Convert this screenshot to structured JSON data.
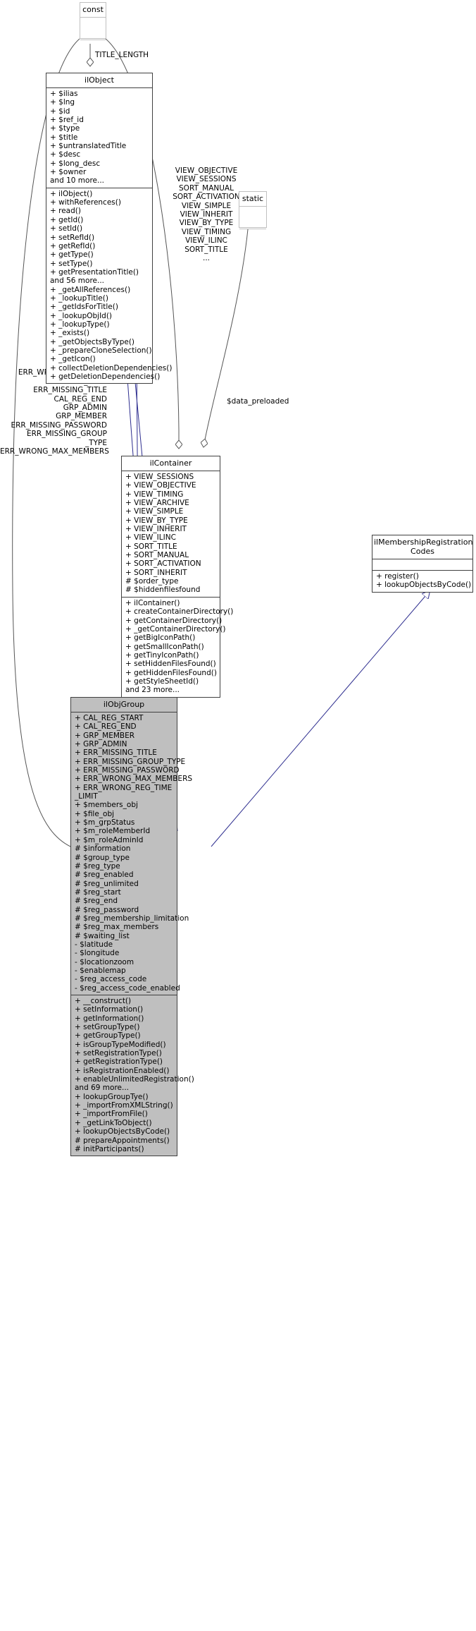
{
  "diagram": {
    "kind": "uml-class-diagram",
    "title": "ilObjGroup class inheritance / collaboration diagram",
    "colors": {
      "inherit_edge": "#2e2e8f",
      "assoc_edge": "#555555",
      "node_border": "#404040",
      "node_border_light": "#c0c0c0",
      "highlight_fill": "#bfbfbf",
      "background": "#ffffff"
    }
  },
  "nodes": {
    "const": {
      "name": "const",
      "attributes": [],
      "methods": []
    },
    "static": {
      "name": "static",
      "attributes": [],
      "methods": []
    },
    "ilObject": {
      "name": "ilObject",
      "attributes": [
        "+ $ilias",
        "+ $lng",
        "+ $id",
        "+ $ref_id",
        "+ $type",
        "+ $title",
        "+ $untranslatedTitle",
        "+ $desc",
        "+ $long_desc",
        "+ $owner",
        "and 10 more..."
      ],
      "methods": [
        "+ ilObject()",
        "+ withReferences()",
        "+ read()",
        "+ getId()",
        "+ setId()",
        "+ setRefId()",
        "+ getRefId()",
        "+ getType()",
        "+ setType()",
        "+ getPresentationTitle()",
        "and 56 more...",
        "+ _getAllReferences()",
        "+ _lookupTitle()",
        "+ _getIdsForTitle()",
        "+ _lookupObjId()",
        "+ _lookupType()",
        "+ _exists()",
        "+ _getObjectsByType()",
        "+ _prepareCloneSelection()",
        "+ _getIcon()",
        "+ collectDeletionDependencies()",
        "+ getDeletionDependencies()"
      ]
    },
    "ilContainer": {
      "name": "ilContainer",
      "attributes": [
        "+ VIEW_SESSIONS",
        "+ VIEW_OBJECTIVE",
        "+ VIEW_TIMING",
        "+ VIEW_ARCHIVE",
        "+ VIEW_SIMPLE",
        "+ VIEW_BY_TYPE",
        "+ VIEW_INHERIT",
        "+ VIEW_ILINC",
        "+ SORT_TITLE",
        "+ SORT_MANUAL",
        "+ SORT_ACTIVATION",
        "+ SORT_INHERIT",
        "# $order_type",
        "# $hiddenfilesfound"
      ],
      "methods": [
        "+ ilContainer()",
        "+ createContainerDirectory()",
        "+ getContainerDirectory()",
        "+ _getContainerDirectory()",
        "+ getBigIconPath()",
        "+ getSmallIconPath()",
        "+ getTinyIconPath()",
        "+ setHiddenFilesFound()",
        "+ getHiddenFilesFound()",
        "+ getStyleSheetId()",
        "and 23 more..."
      ]
    },
    "ilMembershipRegistrationCodes": {
      "name": "ilMembershipRegistration\nCodes",
      "name_lines": [
        "ilMembershipRegistration",
        "Codes"
      ],
      "attributes": [],
      "methods": [
        "+ register()",
        "+ lookupObjectsByCode()"
      ]
    },
    "ilObjGroup": {
      "name": "ilObjGroup",
      "attributes": [
        "+ CAL_REG_START",
        "+ CAL_REG_END",
        "+ GRP_MEMBER",
        "+ GRP_ADMIN",
        "+ ERR_MISSING_TITLE",
        "+ ERR_MISSING_GROUP_TYPE",
        "+ ERR_MISSING_PASSWORD",
        "+ ERR_WRONG_MAX_MEMBERS",
        "+ ERR_WRONG_REG_TIME",
        "_LIMIT",
        "+ $members_obj",
        "+ $file_obj",
        "+ $m_grpStatus",
        "+ $m_roleMemberId",
        "+ $m_roleAdminId",
        "# $information",
        "# $group_type",
        "# $reg_type",
        "# $reg_enabled",
        "# $reg_unlimited",
        "# $reg_start",
        "# $reg_end",
        "# $reg_password",
        "# $reg_membership_limitation",
        "# $reg_max_members",
        "# $waiting_list",
        "- $latitude",
        "- $longitude",
        "- $locationzoom",
        "- $enablemap",
        "- $reg_access_code",
        "- $reg_access_code_enabled"
      ],
      "methods": [
        "+ __construct()",
        "+ setInformation()",
        "+ getInformation()",
        "+ setGroupType()",
        "+ getGroupType()",
        "+ isGroupTypeModified()",
        "+ setRegistrationType()",
        "+ getRegistrationType()",
        "+ isRegistrationEnabled()",
        "+ enableUnlimitedRegistration()",
        "and 69 more...",
        "+ lookupGroupTye()",
        "+ _importFromXMLString()",
        "+ _importFromFile()",
        "+ _getLinkToObject()",
        "+ lookupObjectsByCode()",
        "# prepareAppointments()",
        "# initParticipants()"
      ]
    }
  },
  "edge_labels": {
    "title_length": "TITLE_LENGTH",
    "container_consts": [
      "VIEW_OBJECTIVE",
      "VIEW_SESSIONS",
      "SORT_MANUAL",
      "SORT_ACTIVATION",
      "VIEW_SIMPLE",
      "VIEW_INHERIT",
      "VIEW_BY_TYPE",
      "VIEW_TIMING",
      "VIEW_ILINC",
      "SORT_TITLE",
      "..."
    ],
    "data_preloaded": "$data_preloaded",
    "group_consts": [
      "CAL_REG_START",
      "ERR_WRONG_REG_TIME",
      "_LIMIT",
      "ERR_MISSING_TITLE",
      "CAL_REG_END",
      "GRP_ADMIN",
      "GRP_MEMBER",
      "ERR_MISSING_PASSWORD",
      "ERR_MISSING_GROUP",
      "_TYPE",
      "ERR_WRONG_MAX_MEMBERS"
    ]
  }
}
